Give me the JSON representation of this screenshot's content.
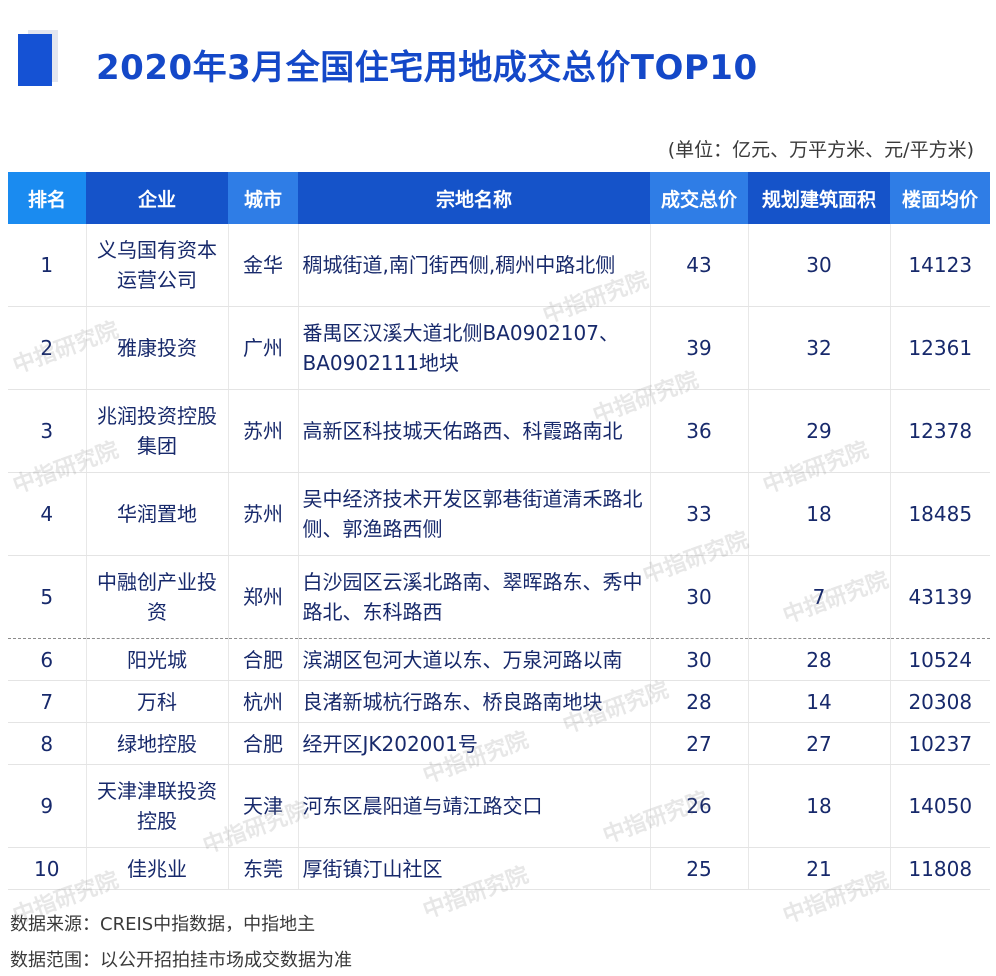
{
  "title": "2020年3月全国住宅用地成交总价TOP10",
  "unit_note": "(单位：亿元、万平方米、元/平方米)",
  "columns": {
    "rank": "排名",
    "enterprise": "企业",
    "city": "城市",
    "land": "宗地名称",
    "total_price": "成交总价",
    "planned_area": "规划建筑面积",
    "floor_price": "楼面均价"
  },
  "rows": [
    {
      "rank": "1",
      "enterprise": "义乌国有资本运营公司",
      "city": "金华",
      "land": "稠城街道,南门街西侧,稠州中路北侧",
      "total_price": "43",
      "planned_area": "30",
      "floor_price": "14123"
    },
    {
      "rank": "2",
      "enterprise": "雅康投资",
      "city": "广州",
      "land": "番禺区汉溪大道北侧BA0902107、BA0902111地块",
      "total_price": "39",
      "planned_area": "32",
      "floor_price": "12361"
    },
    {
      "rank": "3",
      "enterprise": "兆润投资控股集团",
      "city": "苏州",
      "land": "高新区科技城天佑路西、科霞路南北",
      "total_price": "36",
      "planned_area": "29",
      "floor_price": "12378"
    },
    {
      "rank": "4",
      "enterprise": "华润置地",
      "city": "苏州",
      "land": "吴中经济技术开发区郭巷街道清禾路北侧、郭渔路西侧",
      "total_price": "33",
      "planned_area": "18",
      "floor_price": "18485"
    },
    {
      "rank": "5",
      "enterprise": "中融创产业投资",
      "city": "郑州",
      "land": "白沙园区云溪北路南、翠晖路东、秀中路北、东科路西",
      "total_price": "30",
      "planned_area": "7",
      "floor_price": "43139"
    },
    {
      "rank": "6",
      "enterprise": "阳光城",
      "city": "合肥",
      "land": "滨湖区包河大道以东、万泉河路以南",
      "total_price": "30",
      "planned_area": "28",
      "floor_price": "10524"
    },
    {
      "rank": "7",
      "enterprise": "万科",
      "city": "杭州",
      "land": "良渚新城杭行路东、桥良路南地块",
      "total_price": "28",
      "planned_area": "14",
      "floor_price": "20308"
    },
    {
      "rank": "8",
      "enterprise": "绿地控股",
      "city": "合肥",
      "land": "经开区JK202001号",
      "total_price": "27",
      "planned_area": "27",
      "floor_price": "10237"
    },
    {
      "rank": "9",
      "enterprise": "天津津联投资控股",
      "city": "天津",
      "land": "河东区晨阳道与靖江路交口",
      "total_price": "26",
      "planned_area": "18",
      "floor_price": "14050"
    },
    {
      "rank": "10",
      "enterprise": "佳兆业",
      "city": "东莞",
      "land": "厚街镇汀山社区",
      "total_price": "25",
      "planned_area": "21",
      "floor_price": "11808"
    }
  ],
  "footer": {
    "source": "数据来源：CREIS中指数据，中指地主",
    "scope": "数据范围：以公开招拍挂市场成交数据为准"
  },
  "watermark": "中指研究院",
  "colors": {
    "title": "#1448c8",
    "header_dark": "#1553c9",
    "header_light": "#2f7de6",
    "header_rank": "#1a8bf0",
    "cell_text": "#17296b"
  }
}
